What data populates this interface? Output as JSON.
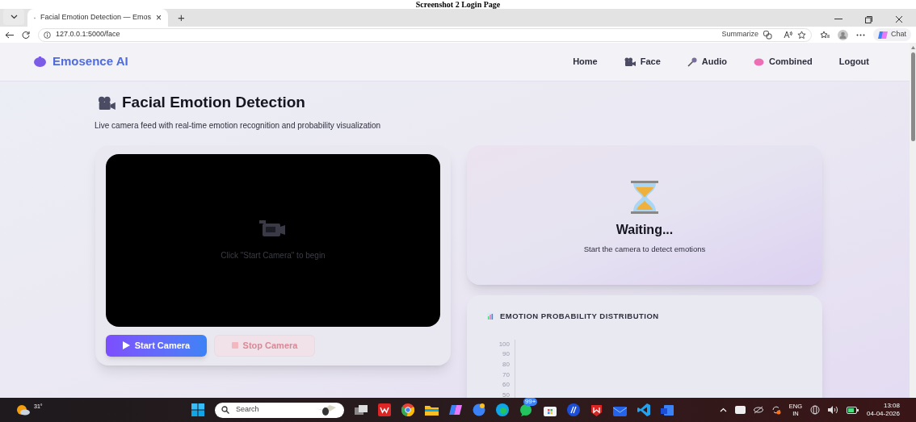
{
  "caption": "Screenshot 2 Login Page",
  "browser": {
    "tab_title": "Facial Emotion Detection — Emos",
    "tab_close": "×",
    "new_tab": "+",
    "address": "127.0.0.1:5000/face",
    "summarize": "Summarize",
    "chat": "Chat"
  },
  "app": {
    "brand": "Emosence AI",
    "nav": [
      {
        "label": "Home",
        "kind": "plain"
      },
      {
        "label": "Face",
        "kind": "camera"
      },
      {
        "label": "Audio",
        "kind": "mic"
      },
      {
        "label": "Combined",
        "kind": "brain"
      },
      {
        "label": "Logout",
        "kind": "plain"
      }
    ]
  },
  "page": {
    "title": "Facial Emotion Detection",
    "subtitle": "Live camera feed with real-time emotion recognition and probability visualization",
    "video_hint": "Click \"Start Camera\" to begin",
    "buttons": [
      {
        "kind": "start",
        "label": "Start Camera",
        "disabled": false
      },
      {
        "kind": "stop",
        "label": "Stop Camera",
        "disabled": true
      }
    ],
    "status": {
      "title": "Waiting...",
      "text": "Start the camera to detect emotions"
    },
    "chart": {
      "title": "EMOTION PROBABILITY DISTRIBUTION",
      "axis_labels": [
        "100",
        "90",
        "80",
        "70",
        "60",
        "50"
      ]
    }
  },
  "taskbar": {
    "weather": "31°",
    "search": "Search",
    "badge": "99+",
    "lang": "ENG",
    "region": "IN",
    "time": "13:08",
    "date": "04-04-2026"
  }
}
